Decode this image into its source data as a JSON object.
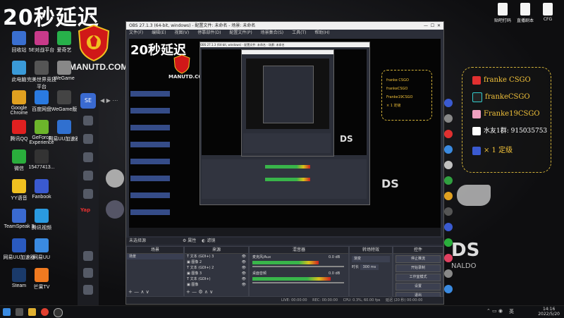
{
  "overlay": {
    "title": "20秒延迟",
    "brand": "MANUTD.COM"
  },
  "desktop_left_icons": [
    {
      "label": "回收站",
      "color": "#3a6fd0"
    },
    {
      "label": "5E对战平台",
      "color": "#c83a8a"
    },
    {
      "label": "爱奇艺",
      "color": "#27b04a"
    },
    {
      "label": "此电脑",
      "color": "#3a9ad8"
    },
    {
      "label": "完美世界竞技平台",
      "color": "#555"
    },
    {
      "label": "WeGame",
      "color": "#888"
    },
    {
      "label": "Google Chrome",
      "color": "#e0a020"
    },
    {
      "label": "百度网盘",
      "color": "#2a7ae0"
    },
    {
      "label": "WeGame版",
      "color": "#444"
    },
    {
      "label": "腾讯QQ",
      "color": "#e02020"
    },
    {
      "label": "GeForce Experience",
      "color": "#6cb52b"
    },
    {
      "label": "网易UU加速器",
      "color": "#3070d0"
    },
    {
      "label": "微信",
      "color": "#2aae3c"
    },
    {
      "label": "15477413...",
      "color": "#333"
    },
    {
      "label": "",
      "color": "#000"
    },
    {
      "label": "YY语音",
      "color": "#f0c020"
    },
    {
      "label": "Fanbook",
      "color": "#3a5ad0"
    },
    {
      "label": "",
      "color": "#000"
    },
    {
      "label": "TeamSpeak 3",
      "color": "#3a6ad0"
    },
    {
      "label": "腾讯视频",
      "color": "#2a9ae0"
    },
    {
      "label": "",
      "color": "#000"
    },
    {
      "label": "网易UU加速器",
      "color": "#2a5ac0"
    },
    {
      "label": "网易UU",
      "color": "#3a8ae0"
    },
    {
      "label": "",
      "color": "#000"
    },
    {
      "label": "Steam",
      "color": "#1a3a6a"
    },
    {
      "label": "芒果TV",
      "color": "#f07a20"
    }
  ],
  "desktop_right_icons": [
    {
      "label": "贴吧打码"
    },
    {
      "label": "直播剧本"
    },
    {
      "label": "CFG"
    }
  ],
  "obs": {
    "title": "OBS 27.1.3 (64-bit, windows) - 配置文件: 未命名 - 场景: 未命名",
    "menu": [
      "文件(F)",
      "编辑(E)",
      "视图(V)",
      "停靠部件(D)",
      "配置文件(P)",
      "场景集合(S)",
      "工具(T)",
      "帮助(H)"
    ],
    "source_bar": {
      "label": "未选择源",
      "props": "属性",
      "filters": "滤镜"
    },
    "scenes": {
      "header": "场景",
      "items": [
        "场景"
      ]
    },
    "sources": {
      "header": "来源",
      "items": [
        "文本 (GDI+) 3",
        "图像 2",
        "文本 (GDI+) 2",
        "图像 3",
        "文本 (GDI+)",
        "图像"
      ]
    },
    "mixer": {
      "header": "混音器",
      "tracks": [
        {
          "name": "麦克风/Aux",
          "db": "0.0 dB",
          "level": 0.72
        },
        {
          "name": "桌面音频",
          "db": "0.0 dB",
          "level": 0.85
        }
      ]
    },
    "transitions": {
      "header": "转场特效",
      "type": "渐变",
      "duration_label": "时长",
      "duration": "300 ms"
    },
    "controls": {
      "header": "控件",
      "buttons": [
        "停止推流",
        "开始录制",
        "工作室模式",
        "设置",
        "退出"
      ]
    },
    "status": {
      "live": "LIVE: 00:00:00",
      "rec": "REC: 00:00:00",
      "cpu": "CPU: 0.3%, 60.00 fps",
      "delay": "延迟 (20 秒) 00:00:00"
    }
  },
  "nested_obs": {
    "title": "OBS 27.1.3 (64-bit, windows) - 配置文件: 未命名 - 场景: 未命名"
  },
  "panel": {
    "rows": [
      {
        "icon": "weibo-icon",
        "text": "franke CSGO",
        "color": "#e03030"
      },
      {
        "icon": "tiktok-icon",
        "text": "frankeCSGO",
        "color": "#222"
      },
      {
        "icon": "bilibili-icon",
        "text": "Franke19CSGO",
        "color": "#f0a0c0"
      },
      {
        "icon": "qq-icon",
        "text": "水友1群: 915035753",
        "color": "#fff"
      },
      {
        "icon": "rocket-icon",
        "text": "× 1 定级",
        "color": "#3a5ad0"
      }
    ]
  },
  "taskbar": {
    "time": "14:16",
    "date": "2022/5/20",
    "ime": "英",
    "apps": [
      "start",
      "task-view",
      "file-explorer",
      "chrome",
      "obs"
    ]
  }
}
